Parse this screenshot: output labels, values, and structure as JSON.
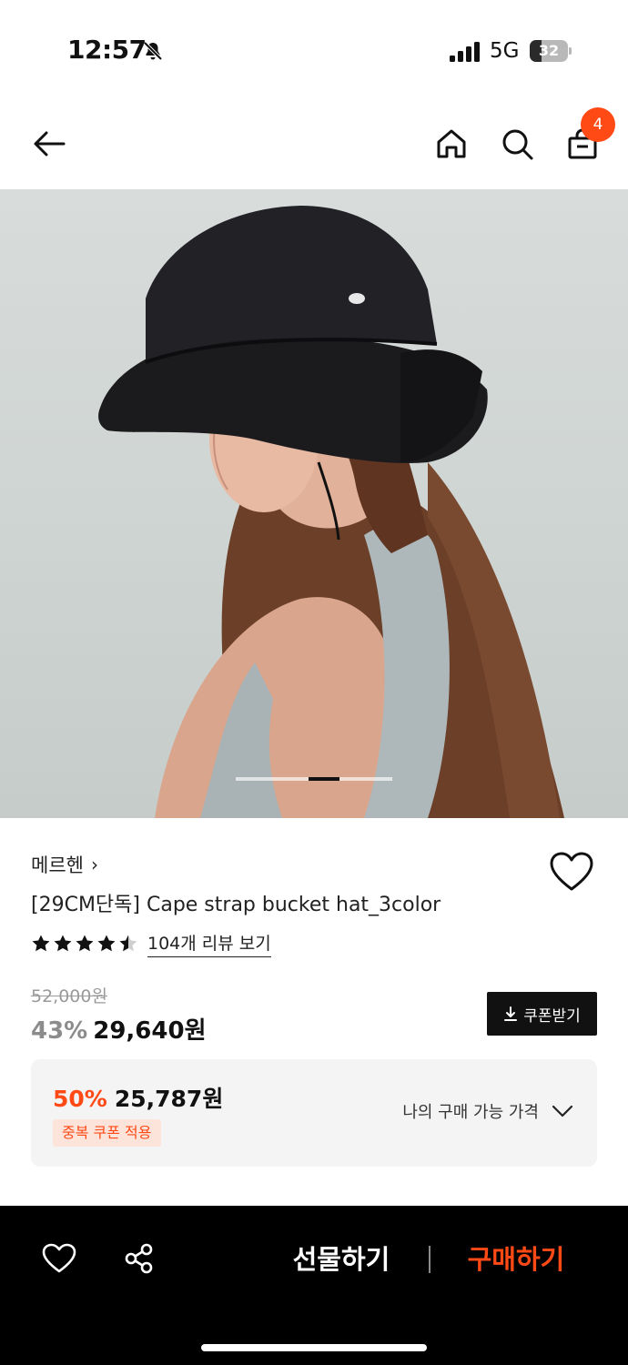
{
  "status_bar": {
    "time": "12:57",
    "network": "5G",
    "battery_level": "32",
    "battery_fraction": 0.32
  },
  "header": {
    "cart_count": "4"
  },
  "gallery": {
    "current_index": 3,
    "total": 5
  },
  "product": {
    "brand": "메르헨",
    "brand_chevron": "›",
    "title": "[29CM단독] Cape strap bucket hat_3color",
    "rating": 4.5,
    "review_link": "104개 리뷰 보기",
    "original_price": "52,000원",
    "discount_rate": "43%",
    "sale_price": "29,640원",
    "coupon_button": "쿠폰받기"
  },
  "best_price": {
    "rate": "50%",
    "price": "25,787원",
    "tag": "중복 쿠폰 적용",
    "my_price_label": "나의 구매 가능 가격"
  },
  "bottom_bar": {
    "gift_label": "선물하기",
    "buy_label": "구매하기"
  },
  "colors": {
    "accent": "#ff4a16",
    "dark": "#111111",
    "muted": "#9a9a9a"
  },
  "icons": [
    "back-arrow-icon",
    "home-icon",
    "search-icon",
    "shopping-bag-icon",
    "heart-icon",
    "share-icon",
    "download-icon",
    "chevron-down-icon",
    "bell-off-icon",
    "star-icon"
  ]
}
